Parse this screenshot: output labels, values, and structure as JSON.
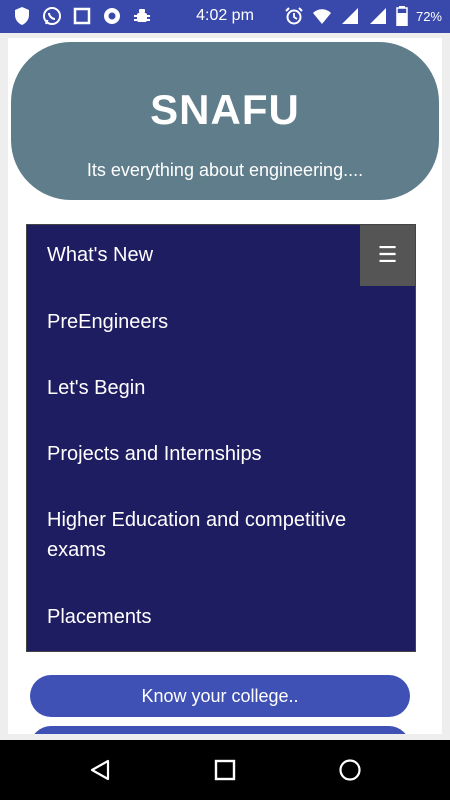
{
  "status_bar": {
    "time": "4:02 pm",
    "battery": "72%",
    "left_icons": [
      "shield-icon",
      "whatsapp-icon",
      "square-icon",
      "chrome-icon",
      "android-debug-icon"
    ],
    "right_icons": [
      "alarm-icon",
      "wifi-icon",
      "signal-icon",
      "signal-icon-2",
      "battery-icon"
    ],
    "bg_color": "#3949ab"
  },
  "header": {
    "title": "SNAFU",
    "subtitle": "Its everything about engineering....",
    "bg_color": "#607d8b"
  },
  "nav": {
    "toggle_glyph": "☰",
    "items": [
      {
        "label": "What's New"
      },
      {
        "label": "PreEngineers"
      },
      {
        "label": "Let's Begin"
      },
      {
        "label": "Projects and Internships"
      },
      {
        "label": "Higher Education and competitive exams"
      },
      {
        "label": "Placements"
      }
    ],
    "bg_color": "#1f1d61"
  },
  "buttons": {
    "know_college": "Know your college.."
  },
  "colors": {
    "accent": "#3f51b5",
    "toggle": "#555555"
  }
}
